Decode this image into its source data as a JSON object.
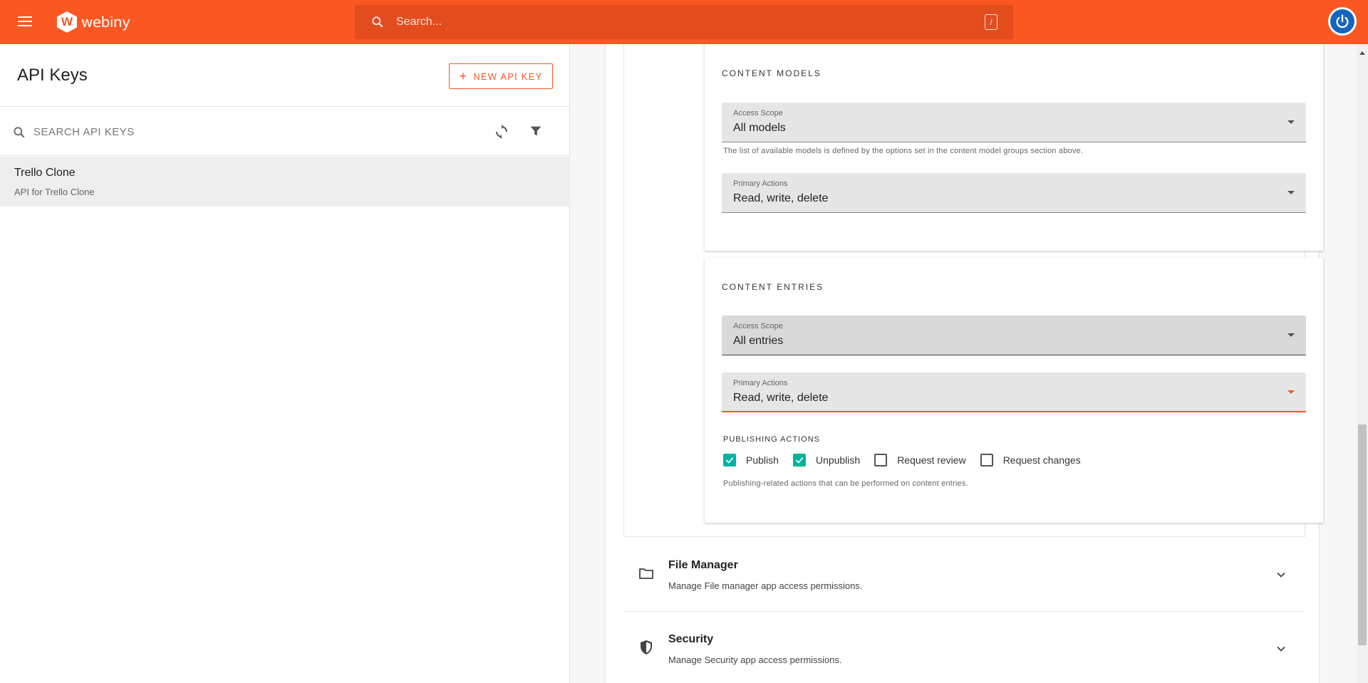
{
  "topbar": {
    "logo_text": "webiny",
    "logo_letter": "W",
    "search_placeholder": "Search...",
    "search_shortcut": "/",
    "brand_color": "#fa5723"
  },
  "left_panel": {
    "title": "API Keys",
    "new_button_label": "NEW API KEY",
    "search_placeholder": "SEARCH API KEYS",
    "items": [
      {
        "title": "Trello Clone",
        "subtitle": "API for Trello Clone"
      }
    ]
  },
  "content_models": {
    "title": "CONTENT MODELS",
    "access_scope": {
      "label": "Access Scope",
      "value": "All models"
    },
    "access_scope_helper": "The list of available models is defined by the options set in the content model groups section above.",
    "primary_actions": {
      "label": "Primary Actions",
      "value": "Read, write, delete"
    }
  },
  "content_entries": {
    "title": "CONTENT ENTRIES",
    "access_scope": {
      "label": "Access Scope",
      "value": "All entries"
    },
    "primary_actions": {
      "label": "Primary Actions",
      "value": "Read, write, delete"
    },
    "publishing_label": "PUBLISHING ACTIONS",
    "publishing_options": [
      {
        "label": "Publish",
        "checked": true
      },
      {
        "label": "Unpublish",
        "checked": true
      },
      {
        "label": "Request review",
        "checked": false
      },
      {
        "label": "Request changes",
        "checked": false
      }
    ],
    "publishing_helper": "Publishing-related actions that can be performed on content entries."
  },
  "accordions": [
    {
      "title": "File Manager",
      "description": "Manage File manager app access permissions.",
      "icon": "folder-icon"
    },
    {
      "title": "Security",
      "description": "Manage Security app access permissions.",
      "icon": "shield-icon"
    }
  ],
  "colors": {
    "accent": "#fa5723",
    "checkbox": "#00b3a0",
    "avatar": "#1565c0"
  }
}
